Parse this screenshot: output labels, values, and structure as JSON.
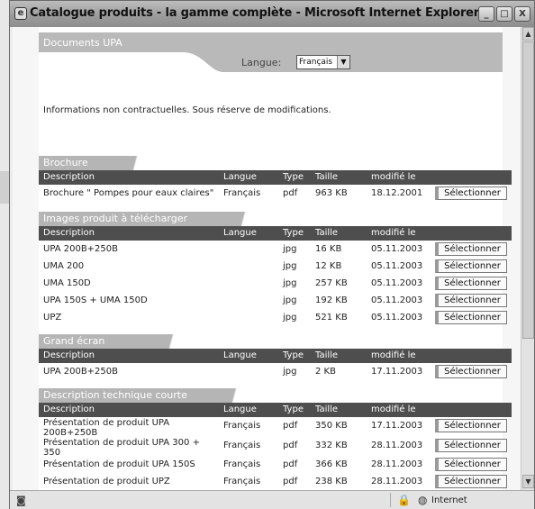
{
  "window": {
    "title": "Catalogue produits - la gamme complète - Microsoft Internet Explorer",
    "title_icon": "e",
    "btn_minimize": "_",
    "btn_maximize": "□",
    "btn_close": "X"
  },
  "page": {
    "top_band_label": "Documents UPA",
    "lang_label": "Langue:",
    "lang_value": "Français",
    "notice": "Informations non contractuelles. Sous réserve de modifications."
  },
  "columns": {
    "desc": "Description",
    "lang": "Langue",
    "type": "Type",
    "size": "Taille",
    "date": "modifié le"
  },
  "select_label": "Sélectionner",
  "sections": [
    {
      "title": "Brochure",
      "rows": [
        {
          "desc": "Brochure \" Pompes pour eaux claires\"",
          "lang": "Français",
          "type": "pdf",
          "size": "963 KB",
          "date": "18.12.2001"
        }
      ]
    },
    {
      "title": "Images produit à télécharger",
      "rows": [
        {
          "desc": "UPA 200B+250B",
          "lang": "",
          "type": "jpg",
          "size": "16 KB",
          "date": "05.11.2003"
        },
        {
          "desc": "UMA 200",
          "lang": "",
          "type": "jpg",
          "size": "12 KB",
          "date": "05.11.2003"
        },
        {
          "desc": "UMA 150D",
          "lang": "",
          "type": "jpg",
          "size": "257 KB",
          "date": "05.11.2003"
        },
        {
          "desc": "UPA 150S + UMA 150D",
          "lang": "",
          "type": "jpg",
          "size": "192 KB",
          "date": "05.11.2003"
        },
        {
          "desc": "UPZ",
          "lang": "",
          "type": "jpg",
          "size": "521 KB",
          "date": "05.11.2003"
        }
      ]
    },
    {
      "title": "Grand écran",
      "rows": [
        {
          "desc": "UPA 200B+250B",
          "lang": "",
          "type": "jpg",
          "size": "2 KB",
          "date": "17.11.2003"
        }
      ]
    },
    {
      "title": "Description technique courte",
      "rows": [
        {
          "desc": "Présentation de produit UPA 200B+250B",
          "lang": "Français",
          "type": "pdf",
          "size": "350 KB",
          "date": "17.11.2003"
        },
        {
          "desc": "Présentation de produit UPA 300 + 350",
          "lang": "Français",
          "type": "pdf",
          "size": "332 KB",
          "date": "28.11.2003"
        },
        {
          "desc": "Présentation de produit UPA 150S",
          "lang": "Français",
          "type": "pdf",
          "size": "366 KB",
          "date": "28.11.2003"
        },
        {
          "desc": "Présentation de produit UPZ",
          "lang": "Français",
          "type": "pdf",
          "size": "238 KB",
          "date": "28.11.2003"
        }
      ]
    }
  ],
  "status": {
    "zone": "Internet",
    "page_icon": "ie-page-icon",
    "lock_icon": "lock-icon",
    "zone_icon": "globe-icon"
  }
}
